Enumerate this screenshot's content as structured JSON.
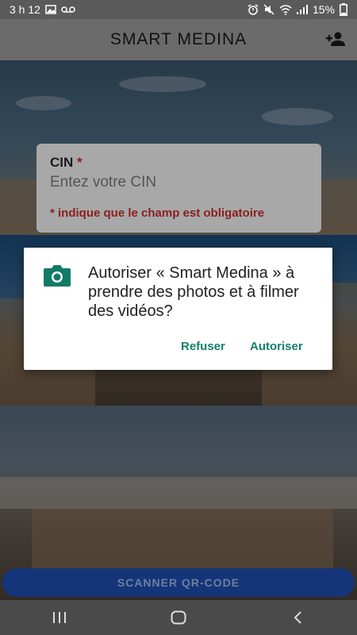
{
  "status_bar": {
    "time": "3 h 12",
    "battery": "15%",
    "icons": [
      "gallery-icon",
      "voicemail-icon",
      "alarm-icon",
      "mute-icon",
      "wifi-icon",
      "signal-icon",
      "battery-icon"
    ]
  },
  "app_bar": {
    "title": "SMART MEDINA",
    "action_icon": "add-person-icon"
  },
  "form": {
    "cin_label": "CIN",
    "required_mark": "*",
    "cin_placeholder": "Entez votre CIN",
    "cin_value": "",
    "required_note": "* indique que le champ est obligatoire"
  },
  "scan_button": {
    "label": "SCANNER QR-CODE"
  },
  "permission_dialog": {
    "icon": "camera-icon",
    "message": "Autoriser « Smart Medina » à prendre des photos et à filmer des vidéos?",
    "deny_label": "Refuser",
    "allow_label": "Autoriser"
  },
  "nav_bar": {
    "buttons": [
      "recent-apps-icon",
      "home-icon",
      "back-icon"
    ]
  },
  "colors": {
    "accent": "#16806e",
    "required": "#8b1c1c",
    "scan_button": "#15357a"
  }
}
